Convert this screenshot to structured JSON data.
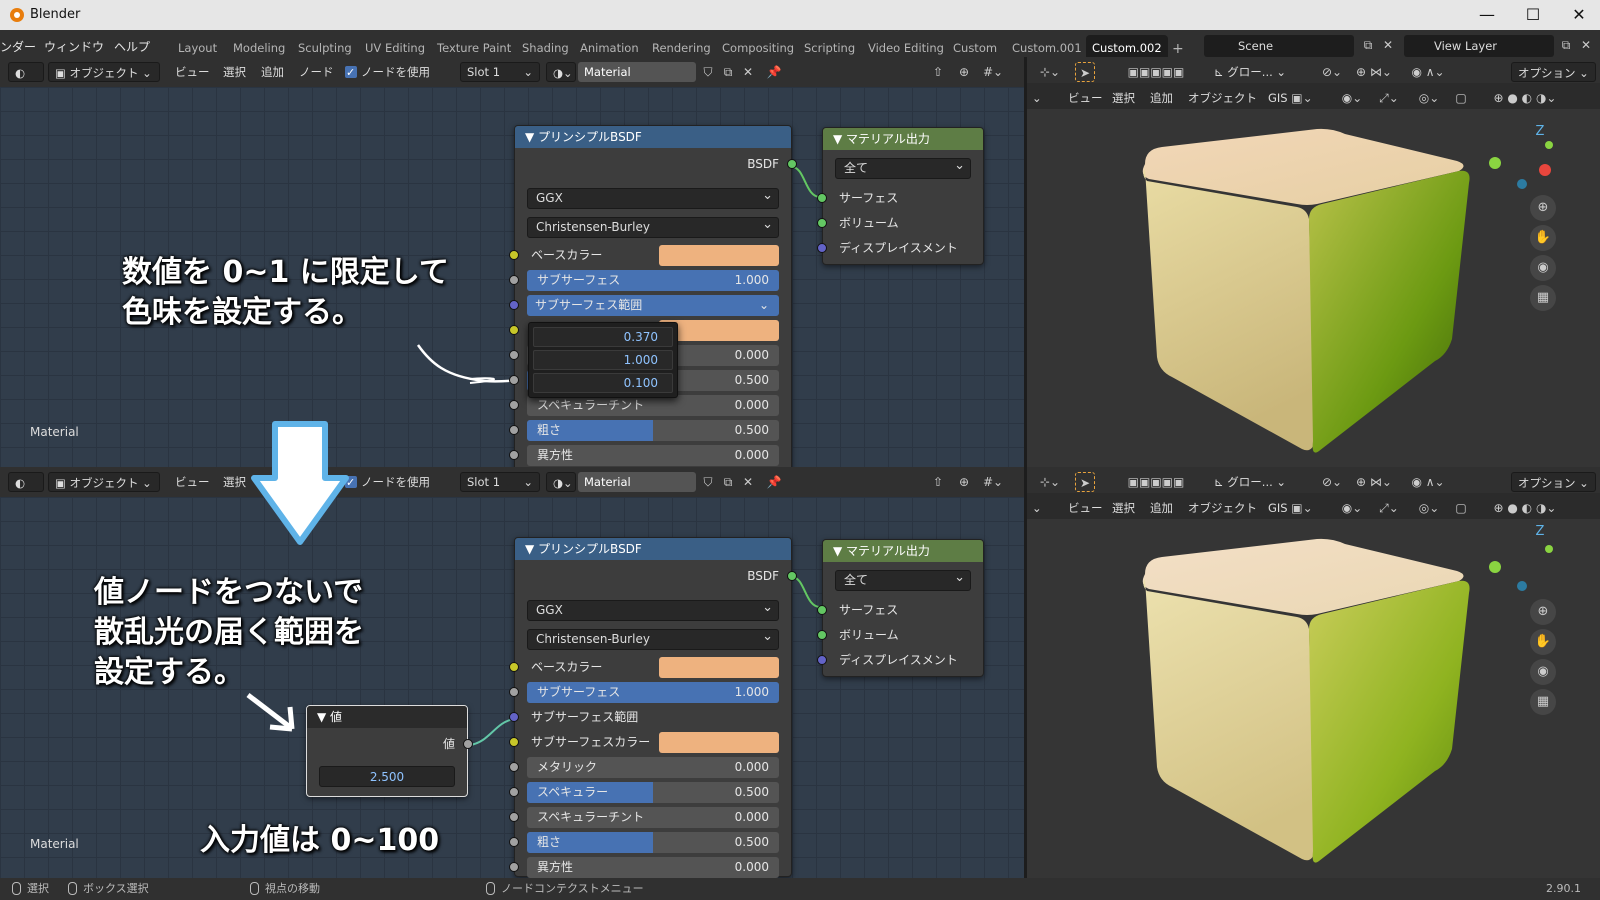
{
  "window": {
    "title": "Blender"
  },
  "menu": {
    "items": [
      "ンダー",
      "ウィンドウ",
      "ヘルプ"
    ]
  },
  "workspace_tabs": [
    "Layout",
    "Modeling",
    "Sculpting",
    "UV Editing",
    "Texture Paint",
    "Shading",
    "Animation",
    "Rendering",
    "Compositing",
    "Scripting",
    "Video Editing",
    "Custom",
    "Custom.001",
    "Custom.002"
  ],
  "active_tab": "Custom.002",
  "scene": {
    "name": "Scene",
    "view_layer": "View Layer"
  },
  "node_header": {
    "object_mode": "オブジェクト",
    "view": "ビュー",
    "select": "選択",
    "add": "追加",
    "node": "ノード",
    "use_nodes": "ノードを使用",
    "slot": "Slot 1",
    "material": "Material"
  },
  "viewport_header": {
    "global": "グロー...",
    "options": "オプション",
    "view": "ビュー",
    "select": "選択",
    "add": "追加",
    "object": "オブジェクト",
    "gis": "GIS"
  },
  "editor_label": "Material",
  "bsdf_node": {
    "title": "プリンシプルBSDF",
    "output": "BSDF",
    "distribution": "GGX",
    "subsurface_method": "Christensen-Burley",
    "base_color": "ベースカラー",
    "subsurface": {
      "label": "サブサーフェス",
      "value": "1.000"
    },
    "subsurface_radius": "サブサーフェス範囲",
    "subsurface_color": "サブサーフェスカラー",
    "metallic": {
      "label": "メタリック",
      "value": "0.000"
    },
    "specular": {
      "label": "スペキュラー",
      "value": "0.500"
    },
    "specular_tint": {
      "label": "スペキュラーチント",
      "value": "0.000"
    },
    "roughness": {
      "label": "粗さ",
      "value": "0.500"
    },
    "anisotropic": {
      "label": "異方性",
      "value": "0.000"
    }
  },
  "popup_values": [
    "0.370",
    "1.000",
    "0.100"
  ],
  "output_node": {
    "title": "マテリアル出力",
    "target": "全て",
    "surface": "サーフェス",
    "volume": "ボリューム",
    "displacement": "ディスプレイスメント"
  },
  "value_node": {
    "title": "値",
    "output": "値",
    "value": "2.500"
  },
  "annotations": {
    "top_line1": "数値を 0~1 に限定して",
    "top_line2": "色味を設定する。",
    "bottom_line1": "値ノードをつないで",
    "bottom_line2": "散乱光の届く範囲を",
    "bottom_line3": "設定する。",
    "range_note": "入力値は 0~100"
  },
  "status_bar": {
    "select": "選択",
    "box_select": "ボックス選択",
    "move_view": "視点の移動",
    "context_menu": "ノードコンテクストメニュー",
    "version": "2.90.1"
  },
  "colors": {
    "base_color_swatch": "#eeb27f",
    "accent": "#4772b3",
    "bsdf_header": "#3a5f86",
    "output_header": "#5e7d45",
    "node_editor_bg": "#313d4b"
  }
}
